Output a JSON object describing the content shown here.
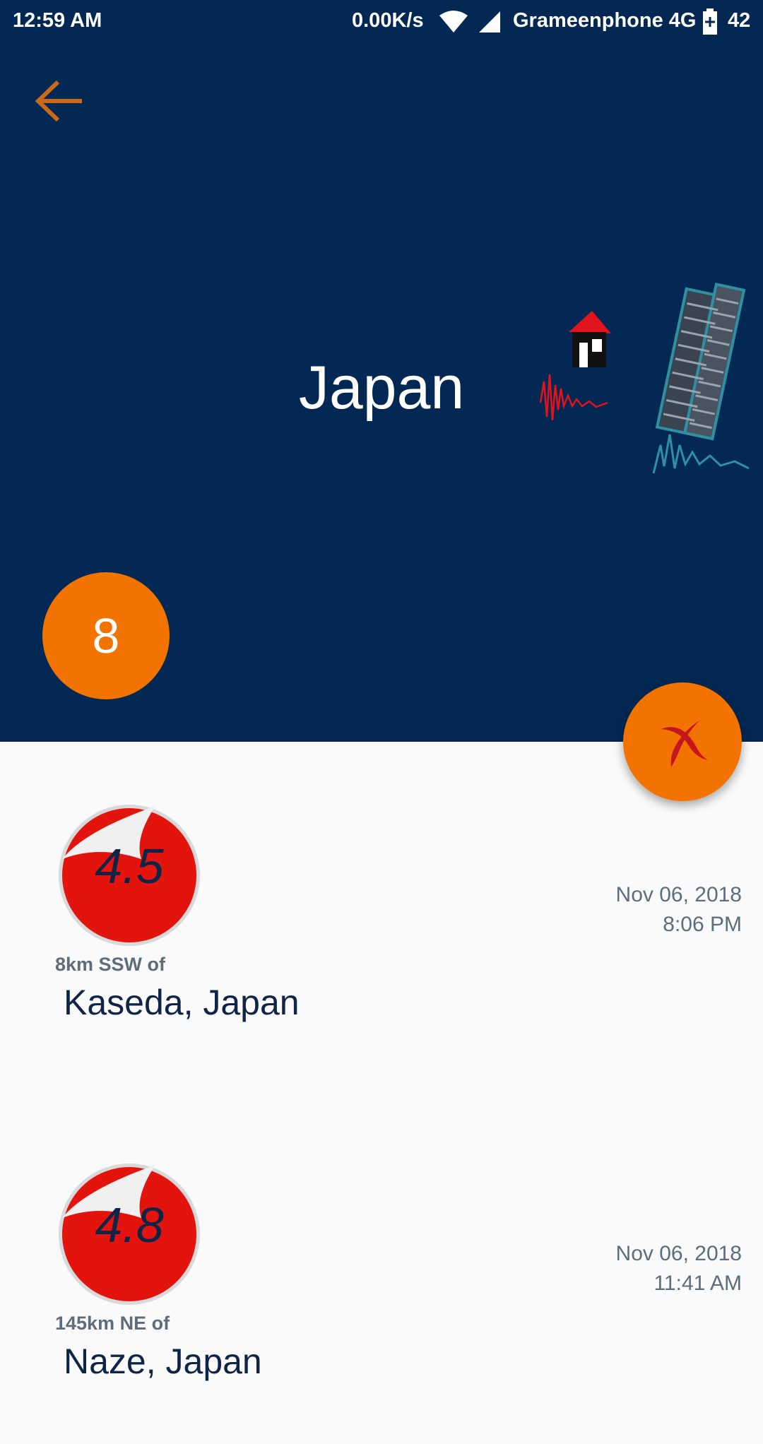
{
  "status": {
    "time": "12:59 AM",
    "net_speed": "0.00K/s",
    "carrier": "Grameenphone 4G",
    "battery": "42"
  },
  "header": {
    "country": "Japan",
    "count": "8",
    "background_color": "#022853",
    "accent_color": "#f27300"
  },
  "quakes": [
    {
      "magnitude": "4.5",
      "distance": "8km SSW  of",
      "place": "Kaseda, Japan",
      "date": "Nov 06, 2018",
      "time": "8:06 PM"
    },
    {
      "magnitude": "4.8",
      "distance": "145km NE  of",
      "place": "Naze, Japan",
      "date": "Nov 06, 2018",
      "time": "11:41 AM"
    }
  ]
}
